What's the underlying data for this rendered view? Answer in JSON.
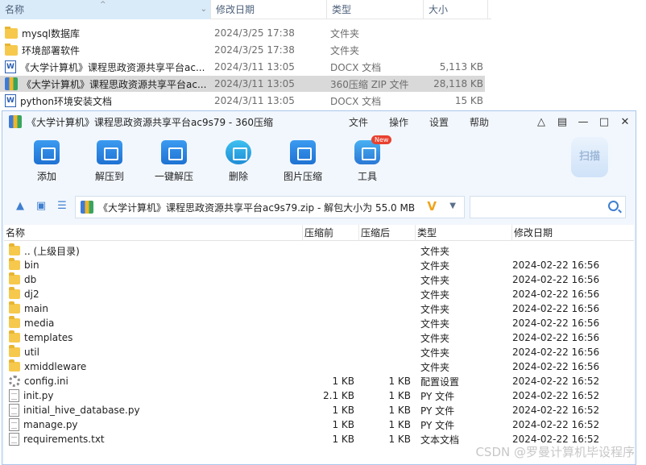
{
  "explorer": {
    "columns": {
      "name": "名称",
      "date": "修改日期",
      "type": "类型",
      "size": "大小"
    },
    "rows": [
      {
        "icon": "folder-icon",
        "name": "mysql数据库",
        "date": "2024/3/25 17:38",
        "type": "文件夹",
        "size": ""
      },
      {
        "icon": "folder-icon",
        "name": "环境部署软件",
        "date": "2024/3/25 17:38",
        "type": "文件夹",
        "size": ""
      },
      {
        "icon": "docx-icon",
        "name": "《大学计算机》课程思政资源共享平台ac...",
        "date": "2024/3/11 13:05",
        "type": "DOCX 文档",
        "size": "5,113 KB"
      },
      {
        "icon": "zip-icon",
        "name": "《大学计算机》课程思政资源共享平台ac...",
        "date": "2024/3/11 13:05",
        "type": "360压缩 ZIP 文件",
        "size": "28,118 KB"
      },
      {
        "icon": "docx-icon",
        "name": "python环境安装文档",
        "date": "2024/3/11 13:05",
        "type": "DOCX 文档",
        "size": "15 KB"
      }
    ],
    "selected_row": 3
  },
  "zipwin": {
    "title": "《大学计算机》课程思政资源共享平台ac9s79 - 360压缩",
    "menus": [
      "文件",
      "操作",
      "设置",
      "帮助"
    ],
    "toolbar": {
      "add": "添加",
      "extract_to": "解压到",
      "one_click_extract": "一键解压",
      "delete": "删除",
      "image_compress": "图片压缩",
      "tools": "工具",
      "new_badge": "New",
      "scan": "扫描"
    },
    "path": "《大学计算机》课程思政资源共享平台ac9s79.zip - 解包大小为 55.0 MB",
    "search_placeholder": "",
    "list": {
      "columns": {
        "name": "名称",
        "before": "压缩前",
        "after": "压缩后",
        "type": "类型",
        "date": "修改日期"
      },
      "rows": [
        {
          "icon": "folder-icon",
          "name": ".. (上级目录)",
          "before": "",
          "after": "",
          "type": "文件夹",
          "date": ""
        },
        {
          "icon": "folder-icon",
          "name": "bin",
          "before": "",
          "after": "",
          "type": "文件夹",
          "date": "2024-02-22 16:56"
        },
        {
          "icon": "folder-icon",
          "name": "db",
          "before": "",
          "after": "",
          "type": "文件夹",
          "date": "2024-02-22 16:56"
        },
        {
          "icon": "folder-icon",
          "name": "dj2",
          "before": "",
          "after": "",
          "type": "文件夹",
          "date": "2024-02-22 16:56"
        },
        {
          "icon": "folder-icon",
          "name": "main",
          "before": "",
          "after": "",
          "type": "文件夹",
          "date": "2024-02-22 16:56"
        },
        {
          "icon": "folder-icon",
          "name": "media",
          "before": "",
          "after": "",
          "type": "文件夹",
          "date": "2024-02-22 16:56"
        },
        {
          "icon": "folder-icon",
          "name": "templates",
          "before": "",
          "after": "",
          "type": "文件夹",
          "date": "2024-02-22 16:56"
        },
        {
          "icon": "folder-icon",
          "name": "util",
          "before": "",
          "after": "",
          "type": "文件夹",
          "date": "2024-02-22 16:56"
        },
        {
          "icon": "folder-icon",
          "name": "xmiddleware",
          "before": "",
          "after": "",
          "type": "文件夹",
          "date": "2024-02-22 16:56"
        },
        {
          "icon": "settings-file-icon",
          "name": "config.ini",
          "before": "1 KB",
          "after": "1 KB",
          "type": "配置设置",
          "date": "2024-02-22 16:52"
        },
        {
          "icon": "file-icon",
          "name": "init.py",
          "before": "2.1 KB",
          "after": "1 KB",
          "type": "PY 文件",
          "date": "2024-02-22 16:52"
        },
        {
          "icon": "file-icon",
          "name": "initial_hive_database.py",
          "before": "1 KB",
          "after": "1 KB",
          "type": "PY 文件",
          "date": "2024-02-22 16:52"
        },
        {
          "icon": "file-icon",
          "name": "manage.py",
          "before": "1 KB",
          "after": "1 KB",
          "type": "PY 文件",
          "date": "2024-02-22 16:52"
        },
        {
          "icon": "file-icon",
          "name": "requirements.txt",
          "before": "1 KB",
          "after": "1 KB",
          "type": "文本文档",
          "date": "2024-02-22 16:52"
        }
      ]
    }
  },
  "watermark": "CSDN @罗曼计算机毕设程序"
}
